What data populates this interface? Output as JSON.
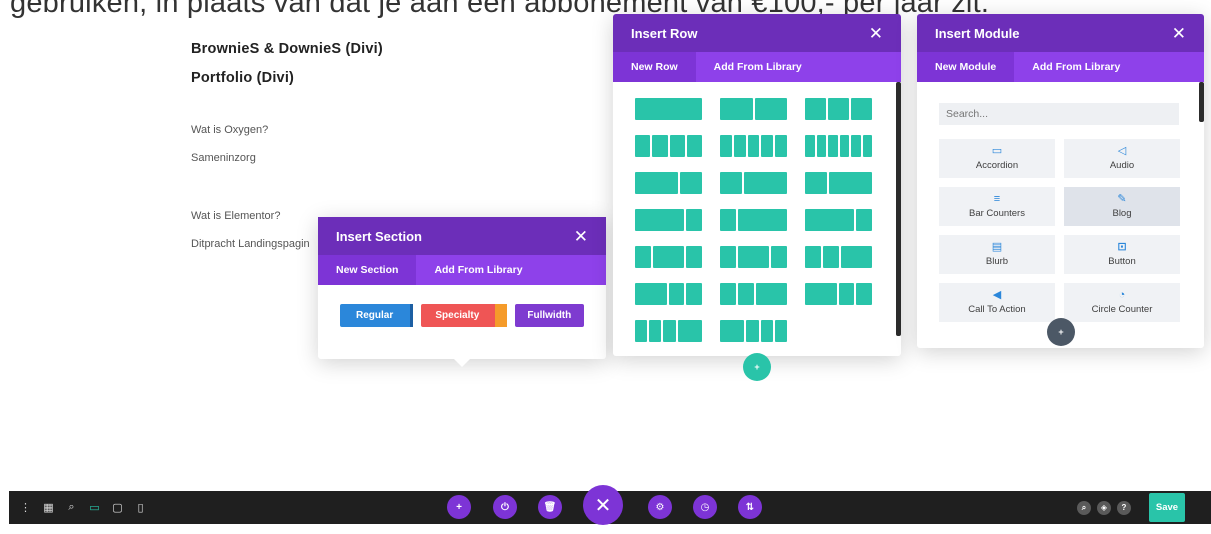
{
  "background": {
    "cutoff_text": "gebruiken, in plaats van dat je aan een abbonement van €100,- per jaar zit.",
    "links": {
      "brownies": "BrownieS & DownieS (Divi)",
      "portfolio": "Portfolio (Divi)",
      "oxygen": "Wat is Oxygen?",
      "sameninzorg": "Sameninzorg",
      "elementor": "Wat is Elementor?",
      "ditpracht": "Ditpracht Landingspagin"
    }
  },
  "insert_section": {
    "title": "Insert Section",
    "close_glyph": "✕",
    "tabs": [
      "New Section",
      "Add From Library"
    ],
    "buttons": [
      "Regular",
      "Specialty",
      "Fullwidth"
    ],
    "colors": {
      "regular": "#2b87da",
      "specialty": "#ef5555",
      "specialty_accent": "#f59b2a",
      "fullwidth": "#7e3bd0"
    }
  },
  "insert_row": {
    "title": "Insert Row",
    "close_glyph": "✕",
    "tabs": [
      "New Row",
      "Add From Library"
    ],
    "layouts": [
      [
        1
      ],
      [
        1,
        1
      ],
      [
        1,
        1,
        1
      ],
      [
        1,
        1,
        1,
        1
      ],
      [
        1,
        1,
        1,
        1,
        1
      ],
      [
        1,
        1,
        1,
        1,
        1,
        1
      ],
      [
        2,
        1
      ],
      [
        1,
        2
      ],
      [
        1,
        2
      ],
      [
        3,
        1
      ],
      [
        1,
        3
      ],
      [
        3,
        1
      ],
      [
        1,
        2,
        1
      ],
      [
        1,
        2,
        1
      ],
      [
        1,
        1,
        2
      ],
      [
        2,
        1,
        1
      ],
      [
        1,
        1,
        2
      ],
      [
        2,
        1,
        1
      ],
      [
        1,
        1,
        1,
        2
      ],
      [
        2,
        1,
        1,
        1
      ]
    ],
    "accent": "#29c4a9"
  },
  "insert_module": {
    "title": "Insert Module",
    "close_glyph": "✕",
    "tabs": [
      "New Module",
      "Add From Library"
    ],
    "search_placeholder": "Search...",
    "modules": [
      {
        "label": "Accordion",
        "icon": "accordion-icon",
        "glyph": "▭"
      },
      {
        "label": "Audio",
        "icon": "audio-icon",
        "glyph": "◁"
      },
      {
        "label": "Bar Counters",
        "icon": "bar-counters-icon",
        "glyph": "≡"
      },
      {
        "label": "Blog",
        "icon": "blog-icon",
        "glyph": "✎"
      },
      {
        "label": "Blurb",
        "icon": "blurb-icon",
        "glyph": "▤"
      },
      {
        "label": "Button",
        "icon": "button-icon",
        "glyph": "⊡"
      },
      {
        "label": "Call To Action",
        "icon": "call-to-action-icon",
        "glyph": "◀"
      },
      {
        "label": "Circle Counter",
        "icon": "circle-counter-icon",
        "glyph": "◔"
      }
    ]
  },
  "bottom_bar": {
    "left_icons": [
      {
        "name": "menu-dots-icon",
        "glyph": "⋮"
      },
      {
        "name": "layout-icon",
        "glyph": "▦"
      },
      {
        "name": "search-icon",
        "glyph": "⌕"
      },
      {
        "name": "desktop-view-icon",
        "glyph": "▭"
      },
      {
        "name": "tablet-view-icon",
        "glyph": "▢"
      },
      {
        "name": "phone-view-icon",
        "glyph": "▯"
      }
    ],
    "center_buttons": [
      {
        "name": "add-icon",
        "glyph": "+"
      },
      {
        "name": "power-icon",
        "glyph": "⏻"
      },
      {
        "name": "trash-icon",
        "glyph": "🗑"
      },
      {
        "name": "close-icon",
        "glyph": "✕"
      },
      {
        "name": "settings-icon",
        "glyph": "⚙"
      },
      {
        "name": "history-icon",
        "glyph": "◷"
      },
      {
        "name": "portability-icon",
        "glyph": "⇅"
      }
    ],
    "right_icons": [
      {
        "name": "search-icon",
        "glyph": "⌕"
      },
      {
        "name": "layers-icon",
        "glyph": "◈"
      },
      {
        "name": "help-icon",
        "glyph": "?"
      }
    ],
    "save_label": "Save",
    "accent_purple": "#7d34d6",
    "accent_green": "#29c4a9"
  },
  "fabs": {
    "row_add_glyph": "+",
    "module_add_glyph": "+"
  }
}
